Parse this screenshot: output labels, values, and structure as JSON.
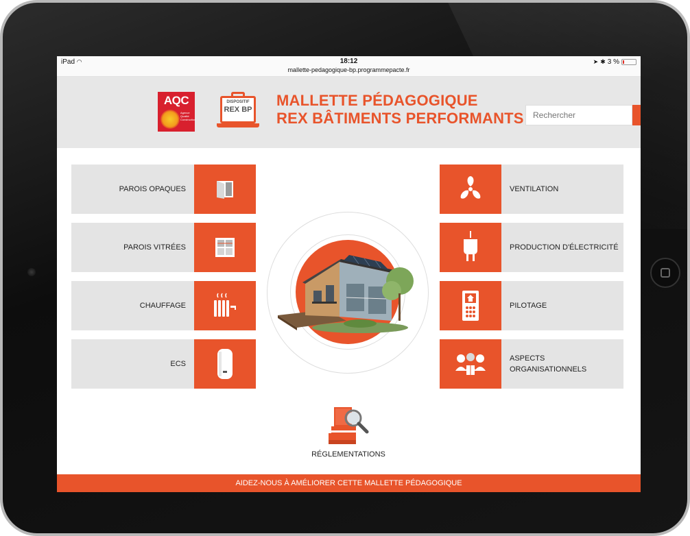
{
  "status_bar": {
    "device": "iPad",
    "time": "18:12",
    "url": "mallette-pedagogique-bp.programmepacte.fr",
    "battery": "3 %"
  },
  "header": {
    "aqc_logo_text": "AQC",
    "aqc_logo_subtext": "Agence Qualité Construction",
    "rex_badge_line1": "DISPOSITIF",
    "rex_badge_line2": "REX BP",
    "title_line1": "MALLETTE PÉDAGOGIQUE",
    "title_line2": "REX BÂTIMENTS PERFORMANTS",
    "search_placeholder": "Rechercher"
  },
  "left_tiles": [
    {
      "label": "PAROIS OPAQUES",
      "icon": "door-panel-icon"
    },
    {
      "label": "PAROIS VITRÉES",
      "icon": "window-icon"
    },
    {
      "label": "CHAUFFAGE",
      "icon": "radiator-icon"
    },
    {
      "label": "ECS",
      "icon": "water-heater-icon"
    }
  ],
  "right_tiles": [
    {
      "label": "VENTILATION",
      "icon": "fan-icon"
    },
    {
      "label": "PRODUCTION D'ÉLECTRICITÉ",
      "icon": "plug-icon"
    },
    {
      "label": "PILOTAGE",
      "icon": "thermostat-icon"
    },
    {
      "label": "ASPECTS ORGANISATIONNELS",
      "icon": "people-icon"
    }
  ],
  "center": {
    "icon": "house-illustration"
  },
  "reglementations_label": "RÉGLEMENTATIONS",
  "footer_text": "AIDEZ-NOUS À AMÉLIORER CETTE MALLETTE PÉDAGOGIQUE",
  "colors": {
    "accent": "#e8542b",
    "tile_bg": "#e4e4e4",
    "header_bg": "#e7e7e7"
  }
}
